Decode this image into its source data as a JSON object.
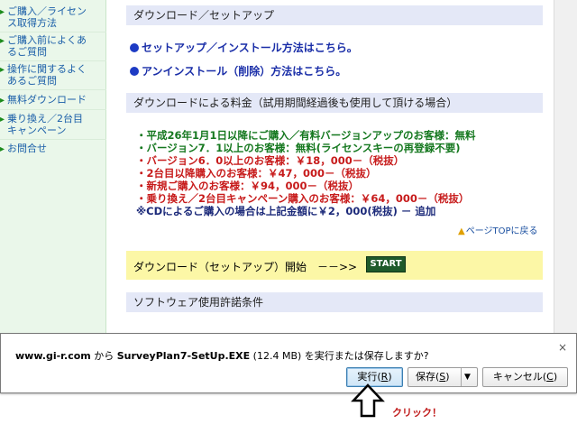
{
  "sidebar": {
    "items": [
      {
        "label": "ご購入／ライセン\nス取得方法"
      },
      {
        "label": "ご購入前によくあ\nるご質問"
      },
      {
        "label": "操作に関するよく\nあるご質問"
      },
      {
        "label": "無料ダウンロード"
      },
      {
        "label": "乗り換え／2台目\nキャンペーン"
      },
      {
        "label": "お問合せ"
      }
    ]
  },
  "main": {
    "setup_header": "ダウンロード／セットアップ",
    "install_link": "セットアップ／インストール方法はこちら。",
    "uninstall_link": "アンインストール（削除）方法はこちら。",
    "price_header": "ダウンロードによる料金（試用期間経過後も使用して頂ける場合）",
    "prices": [
      "・平成26年1月1日以降にご購入／有料バージョンアップのお客様：無料",
      "・バージョン7．1以上のお客様：無料(ライセンスキーの再登録不要)",
      "・バージョン6．0以上のお客様：￥18，000－（税抜）",
      "・2台目以降購入のお客様：￥47，000－（税抜）",
      "・新規ご購入のお客様：￥94，000－（税抜）",
      "・乗り換え／2台目キャンペーン購入のお客様：￥64，000－（税抜）",
      "※CDによるご購入の場合は上記金額に￥2，000(税抜) － 追加"
    ],
    "page_top_link": "ページTOPに戻る",
    "download_start_text": "ダウンロード（セットアップ）開始　－－>>",
    "start_button": "START",
    "license_header": "ソフトウェア使用許諾条件"
  },
  "download_bar": {
    "site": "www.gi-r.com",
    "from_text": " から ",
    "filename": "SurveyPlan7-SetUp.EXE",
    "size_text": " (12.4 MB) を実行または保存しますか?",
    "run_label": "実行(",
    "run_key": "R",
    "save_label": "保存(",
    "save_key": "S",
    "cancel_label": "キャンセル(",
    "cancel_key": "C",
    "close_glyph": "×"
  },
  "annotation": {
    "click_label": "クリック！"
  },
  "colors": {
    "sidebar_bg": "#eaf7ea",
    "section_header_bg": "#e4e8f7",
    "download_band_bg": "#fcf7a6",
    "start_button_bg": "#1f5a2a",
    "link_blue": "#1a2ea8",
    "price_red": "#c71b1b",
    "price_green": "#15781f"
  }
}
